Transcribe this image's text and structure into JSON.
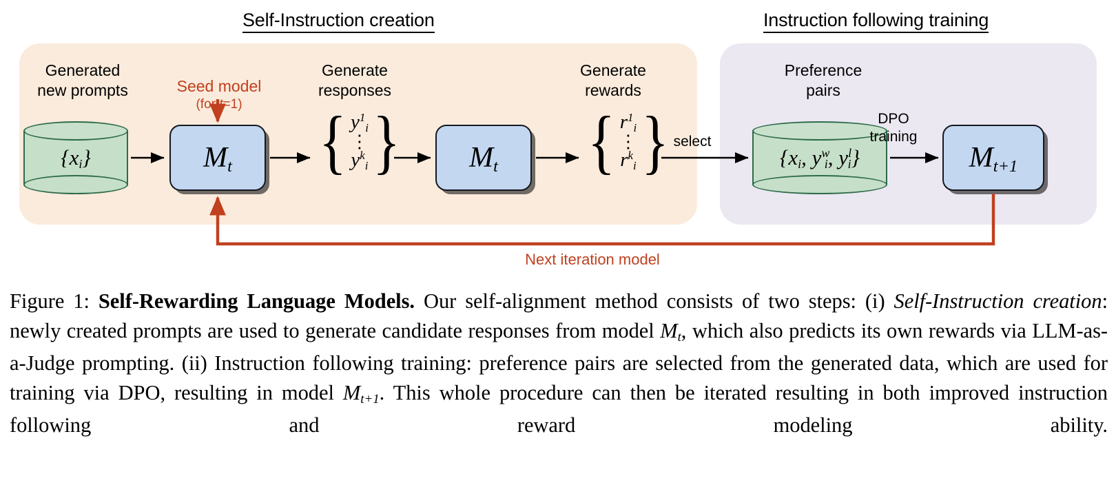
{
  "figure": {
    "headers": {
      "left": "Self-Instruction creation",
      "right": "Instruction following training"
    },
    "panels": {
      "left_color": "#FBEBDC",
      "right_color": "#EBE8F2"
    },
    "colors": {
      "accent_red": "#C0401F",
      "cylinder_fill": "#C6DFC9",
      "cylinder_stroke": "#2E6B4A",
      "model_box_fill": "#C3D7F0",
      "model_box_stroke": "#14181F"
    },
    "node_captions": {
      "generated_prompts": "Generated\nnew prompts",
      "seed_model": "Seed model",
      "seed_model_sub_prefix": "(for ",
      "seed_model_sub_var": "t",
      "seed_model_sub_suffix": "=1)",
      "generate_responses": "Generate\nresponses",
      "generate_rewards": "Generate\nrewards",
      "preference_pairs": "Preference\npairs"
    },
    "nodes": {
      "prompts_db": {
        "base": "{x",
        "sub": "i",
        "close": "}"
      },
      "model_t_first": {
        "base": "M",
        "sub": "t"
      },
      "model_t_second": {
        "base": "M",
        "sub": "t"
      },
      "model_t_plus_1": {
        "base": "M",
        "sub": "t+1"
      },
      "preference_db": {
        "open": "{x",
        "x_sub": "i",
        "comma1": ", y",
        "y1_sup": "w",
        "y1_sub": "i",
        "comma2": ", y",
        "y2_sup": "l",
        "y2_sub": "i",
        "close": "}"
      }
    },
    "responses_set": {
      "first": {
        "base": "y",
        "sup": "1",
        "sub": "i"
      },
      "dots": "⋮",
      "last": {
        "base": "y",
        "sup": "k",
        "sub": "i"
      }
    },
    "rewards_set": {
      "first": {
        "base": "r",
        "sup": "1",
        "sub": "i"
      },
      "dots": "⋮",
      "last": {
        "base": "r",
        "sup": "k",
        "sub": "i"
      }
    },
    "edge_labels": {
      "select": "select",
      "dpo_training": "DPO\ntraining",
      "next_iteration": "Next iteration model"
    }
  },
  "caption": {
    "figure_number": "Figure 1:",
    "title": "Self-Rewarding Language Models.",
    "text_1": " Our self-alignment method consists of two steps: (i) ",
    "emph_1": "Self-Instruction creation",
    "text_2": ": newly created prompts are used to generate candidate responses from model ",
    "math_1_base": "M",
    "math_1_sub": "t",
    "text_3": ", which also predicts its own rewards via LLM-as-a-Judge prompting. (ii) Instruction following training: preference pairs are selected from the generated data, which are used for training via DPO, resulting in model ",
    "math_2_base": "M",
    "math_2_sub": "t+1",
    "text_4": ". This whole procedure can then be iterated resulting in both improved instruction following and reward modeling ability."
  }
}
